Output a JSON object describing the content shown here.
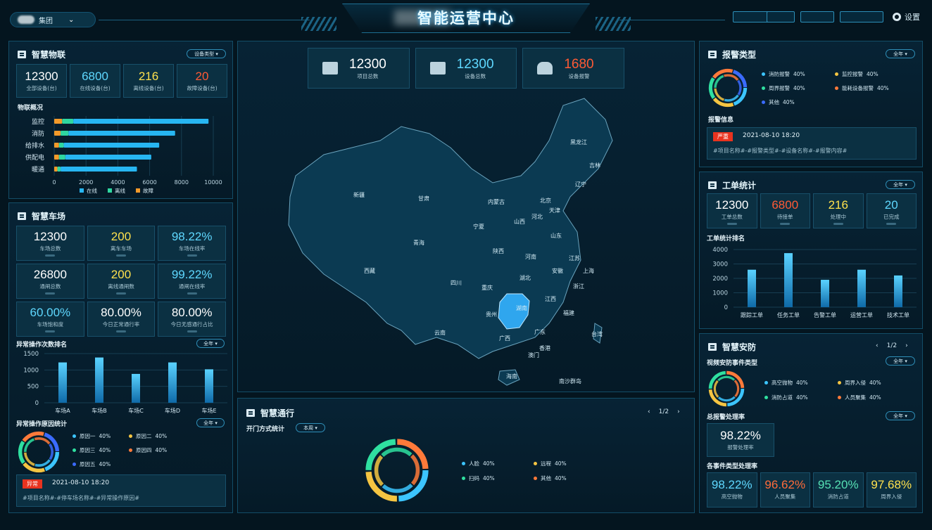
{
  "header": {
    "org": "集团",
    "title": "智能运营中心",
    "settings": "设置"
  },
  "iot": {
    "title": "智慧物联",
    "select": "设备类型",
    "stats": [
      {
        "value": "12300",
        "label": "全部设备(台)",
        "color": "#ffffff"
      },
      {
        "value": "6800",
        "label": "在线设备(台)",
        "color": "#5fd8ff"
      },
      {
        "value": "216",
        "label": "离线设备(台)",
        "color": "#ffe14d"
      },
      {
        "value": "20",
        "label": "故障设备(台)",
        "color": "#ff5a35"
      }
    ],
    "overview_title": "物联概况"
  },
  "parking": {
    "title": "智慧车场",
    "stats": [
      {
        "value": "12300",
        "label": "车场总数",
        "color": "#ffffff"
      },
      {
        "value": "200",
        "label": "离车车场",
        "color": "#ffe14d"
      },
      {
        "value": "98.22%",
        "label": "车场在线率",
        "color": "#5fd8ff"
      },
      {
        "value": "26800",
        "label": "通闸总数",
        "color": "#ffffff"
      },
      {
        "value": "200",
        "label": "离线通闸数",
        "color": "#ffe14d"
      },
      {
        "value": "99.22%",
        "label": "通闸在线率",
        "color": "#5fd8ff"
      },
      {
        "value": "60.00%",
        "label": "车场饱和度",
        "color": "#5fd8ff"
      },
      {
        "value": "80.00%",
        "label": "今日正常通行率",
        "color": "#ffffff"
      },
      {
        "value": "80.00%",
        "label": "今日无感通行占比",
        "color": "#ffffff"
      }
    ],
    "ranking_title": "异常操作次数排名",
    "ranking_select": "全年",
    "reason_title": "异常操作原因统计",
    "reason_select": "全年",
    "reasons": [
      {
        "name": "原因一",
        "pct": "40%",
        "color": "#3cc5ff"
      },
      {
        "name": "原因二",
        "pct": "40%",
        "color": "#f5c542"
      },
      {
        "name": "原因三",
        "pct": "40%",
        "color": "#2fe0a0"
      },
      {
        "name": "原因四",
        "pct": "40%",
        "color": "#ff7a3a"
      },
      {
        "name": "原因五",
        "pct": "40%",
        "color": "#3b6bff"
      }
    ],
    "alert": {
      "tag": "异常",
      "time": "2021-08-10 18:20",
      "text": "#项目名称#-#停车场名称#-#异常操作原因#"
    }
  },
  "kpis": [
    {
      "value": "12300",
      "label": "项目总数",
      "color": "#ffffff"
    },
    {
      "value": "12300",
      "label": "设备总数",
      "color": "#5fd8ff"
    },
    {
      "value": "1680",
      "label": "设备报警",
      "color": "#ff5a35"
    }
  ],
  "map": {
    "regions": [
      "新疆",
      "西藏",
      "青海",
      "甘肃",
      "内蒙古",
      "宁夏",
      "陕西",
      "山西",
      "北京",
      "天津",
      "河北",
      "山东",
      "河南",
      "四川",
      "重庆",
      "湖北",
      "安徽",
      "江苏",
      "上海",
      "浙江",
      "湖南",
      "江西",
      "福建",
      "贵州",
      "云南",
      "广西",
      "广东",
      "香港",
      "澳门",
      "海南",
      "台湾",
      "黑龙江",
      "吉林",
      "辽宁",
      "南沙群岛"
    ]
  },
  "access": {
    "title": "智慧通行",
    "page": "1/2",
    "sub_title": "开门方式统计",
    "select": "本周",
    "legend": [
      {
        "name": "人脸",
        "pct": "40%",
        "color": "#3cc5ff"
      },
      {
        "name": "远程",
        "pct": "40%",
        "color": "#f5c542"
      },
      {
        "name": "扫码",
        "pct": "40%",
        "color": "#2fe0a0"
      },
      {
        "name": "其他",
        "pct": "40%",
        "color": "#ff7a3a"
      }
    ]
  },
  "alarm": {
    "title": "报警类型",
    "select": "全年",
    "legend": [
      {
        "name": "消防报警",
        "pct": "40%",
        "color": "#3cc5ff"
      },
      {
        "name": "监控报警",
        "pct": "40%",
        "color": "#f5c542"
      },
      {
        "name": "周界报警",
        "pct": "40%",
        "color": "#2fe0a0"
      },
      {
        "name": "能耗设备报警",
        "pct": "40%",
        "color": "#ff7a3a"
      },
      {
        "name": "其他",
        "pct": "40%",
        "color": "#3b6bff"
      }
    ],
    "info_title": "报警信息",
    "alert": {
      "tag": "严重",
      "time": "2021-08-10 18:20",
      "text": "#项目名称#-#报警类型#-#设备名称#-#报警内容#"
    }
  },
  "workorder": {
    "title": "工单统计",
    "select": "全年",
    "stats": [
      {
        "value": "12300",
        "label": "工单总数",
        "color": "#ffffff"
      },
      {
        "value": "6800",
        "label": "待接单",
        "color": "#ff5a35"
      },
      {
        "value": "216",
        "label": "处理中",
        "color": "#ffe14d"
      },
      {
        "value": "20",
        "label": "已完成",
        "color": "#5fd8ff"
      }
    ],
    "ranking_title": "工单统计排名"
  },
  "security": {
    "title": "智慧安防",
    "page": "1/2",
    "event_title": "视频安防事件类型",
    "event_select": "全年",
    "legend": [
      {
        "name": "高空抛物",
        "pct": "40%",
        "color": "#3cc5ff"
      },
      {
        "name": "周界入侵",
        "pct": "40%",
        "color": "#f5c542"
      },
      {
        "name": "消防占道",
        "pct": "40%",
        "color": "#2fe0a0"
      },
      {
        "name": "人员聚集",
        "pct": "40%",
        "color": "#ff7a3a"
      }
    ],
    "rate_title": "总报警处理率",
    "rate_select": "全年",
    "rate": {
      "value": "98.22%",
      "label": "报警处理率"
    },
    "each_title": "各事件类型处理率",
    "each": [
      {
        "value": "98.22%",
        "label": "高空抛物",
        "color": "#5fd8ff"
      },
      {
        "value": "96.62%",
        "label": "人员聚集",
        "color": "#ff6b3a"
      },
      {
        "value": "95.20%",
        "label": "消防占道",
        "color": "#56e0b4"
      },
      {
        "value": "97.68%",
        "label": "周界入侵",
        "color": "#ffe14d"
      }
    ]
  },
  "chart_data": [
    {
      "type": "bar",
      "title": "物联概况",
      "orientation": "horizontal",
      "categories": [
        "监控",
        "消防",
        "给排水",
        "供配电",
        "暖通"
      ],
      "series": [
        {
          "name": "在线",
          "values": [
            8500,
            6700,
            6000,
            5400,
            4800
          ]
        },
        {
          "name": "离线",
          "values": [
            700,
            500,
            300,
            400,
            200
          ]
        },
        {
          "name": "故障",
          "values": [
            500,
            400,
            300,
            300,
            200
          ]
        }
      ],
      "xlim": [
        0,
        10000
      ],
      "xticks": [
        "0",
        "2000",
        "4000",
        "6000",
        "8000",
        "10000"
      ],
      "legend": "bottom",
      "colors": [
        "#27b6f2",
        "#2fd7a0",
        "#f39a2a"
      ]
    },
    {
      "type": "bar",
      "title": "异常操作次数排名",
      "categories": [
        "车场A",
        "车场B",
        "车场C",
        "车场D",
        "车场E"
      ],
      "values": [
        1230,
        1380,
        880,
        1230,
        1020
      ],
      "ylim": [
        0,
        1500
      ],
      "yticks": [
        "0",
        "500",
        "1000",
        "1500"
      ]
    },
    {
      "type": "bar",
      "title": "工单统计排名",
      "categories": [
        "跟踪工单",
        "任务工单",
        "告警工单",
        "运营工单",
        "技术工单"
      ],
      "values": [
        2600,
        3750,
        1900,
        2600,
        2200
      ],
      "ylim": [
        0,
        4000
      ],
      "yticks": [
        "0",
        "1000",
        "2000",
        "3000",
        "4000"
      ]
    }
  ]
}
